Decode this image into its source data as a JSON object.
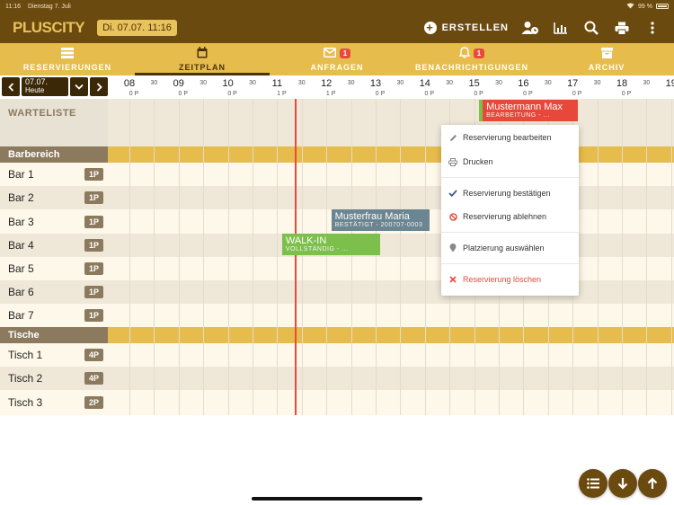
{
  "statusbar": {
    "time": "11:16",
    "date": "Dienstag 7. Juli",
    "battery": "99 %"
  },
  "header": {
    "logo": "PLUSCITY",
    "datetime": "Di. 07.07. 11:16",
    "create_label": "ERSTELLEN",
    "icons": [
      "user-clock-icon",
      "bar-chart-icon",
      "search-icon",
      "printer-icon",
      "more-vertical-icon"
    ]
  },
  "tabs": [
    {
      "label": "RESERVIERUNGEN",
      "icon": "list-icon",
      "badge": ""
    },
    {
      "label": "ZEITPLAN",
      "icon": "calendar-icon",
      "badge": ""
    },
    {
      "label": "ANFRAGEN",
      "icon": "envelope-icon",
      "badge": "1"
    },
    {
      "label": "BENACHRICHTIGUNGEN",
      "icon": "bell-icon",
      "badge": "1"
    },
    {
      "label": "ARCHIV",
      "icon": "archive-icon",
      "badge": ""
    }
  ],
  "active_tab": "ZEITPLAN",
  "date_nav": {
    "date": "07.07.",
    "sub": "Heute"
  },
  "timeline": {
    "hours": [
      "08",
      "09",
      "10",
      "11",
      "12",
      "13",
      "14",
      "15",
      "16",
      "17",
      "18",
      "19"
    ],
    "half": "30",
    "p_labels": [
      {
        "hour": 8,
        "text": "0 P"
      },
      {
        "hour": 9,
        "text": "0 P"
      },
      {
        "hour": 10,
        "text": "0 P"
      },
      {
        "hour": 11,
        "text": "1 P"
      },
      {
        "hour": 12,
        "text": "1 P"
      },
      {
        "hour": 13,
        "text": "0 P"
      },
      {
        "hour": 14,
        "text": "0 P"
      },
      {
        "hour": 15,
        "text": "0 P"
      },
      {
        "hour": 16,
        "text": "0 P"
      },
      {
        "hour": 17,
        "text": "0 P"
      },
      {
        "hour": 18,
        "text": "0 P"
      }
    ]
  },
  "waitlist_label": "WARTELISTE",
  "sections": [
    {
      "title": "Barbereich",
      "rows": [
        {
          "name": "Bar 1",
          "cap": "1P"
        },
        {
          "name": "Bar 2",
          "cap": "1P"
        },
        {
          "name": "Bar 3",
          "cap": "1P"
        },
        {
          "name": "Bar 4",
          "cap": "1P"
        },
        {
          "name": "Bar 5",
          "cap": "1P"
        },
        {
          "name": "Bar 6",
          "cap": "1P"
        },
        {
          "name": "Bar 7",
          "cap": "1P"
        }
      ]
    },
    {
      "title": "Tische",
      "rows": [
        {
          "name": "Tisch 1",
          "cap": "4P"
        },
        {
          "name": "Tisch 2",
          "cap": "4P"
        },
        {
          "name": "Tisch 3",
          "cap": "2P"
        }
      ]
    }
  ],
  "reservations": [
    {
      "name": "Mustermann Max",
      "sub": "BEARBEITUNG - ...",
      "color": "#e8483a",
      "row": "waitlist",
      "start": 15.1,
      "end": 17.1
    },
    {
      "name": "Musterfrau Maria",
      "sub": "BESTÄTIGT - 200707-0003",
      "color": "#6b8591",
      "row": "Bar 3",
      "start": 12.1,
      "end": 14.1
    },
    {
      "name": "WALK-IN",
      "sub": "VOLLSTÄNDIG - ...",
      "color": "#7cbf4a",
      "row": "Bar 4",
      "start": 11.1,
      "end": 13.1
    }
  ],
  "context_menu": {
    "items": [
      {
        "label": "Reservierung bearbeiten",
        "icon": "pencil-icon",
        "color": "#333333"
      },
      {
        "label": "Drucken",
        "icon": "printer-icon",
        "color": "#333333"
      },
      {
        "label": "Reservierung bestätigen",
        "icon": "check-icon",
        "color": "#333333"
      },
      {
        "label": "Reservierung ablehnen",
        "icon": "ban-icon",
        "color": "#333333"
      },
      {
        "label": "Platzierung auswählen",
        "icon": "map-pin-icon",
        "color": "#333333"
      },
      {
        "label": "Reservierung löschen",
        "icon": "x-icon",
        "color": "#e8483a"
      }
    ]
  },
  "fabs": [
    "list-icon",
    "arrow-down-icon",
    "arrow-up-icon"
  ],
  "colors": {
    "brown": "#6b4a10",
    "gold": "#e6bc4c",
    "now_line": "#e84a3c",
    "accent_red": "#e8483a"
  }
}
